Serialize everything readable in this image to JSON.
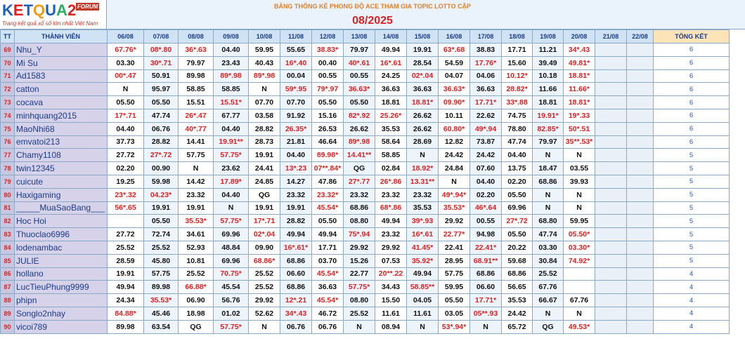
{
  "logo": {
    "brand": "KETQUA2",
    "forum": "FORUM",
    "tagline": "Trang kết quả xổ số lớn nhất Việt Nam"
  },
  "header": {
    "title": "BẢNG THỐNG KÊ PHONG ĐỘ ACE THAM GIA TOPIC  LOTTO CẶP",
    "month": "08/2025"
  },
  "columns": [
    "TT",
    "THÀNH VIÊN",
    "06/08",
    "07/08",
    "08/08",
    "09/08",
    "10/08",
    "11/08",
    "12/08",
    "13/08",
    "14/08",
    "15/08",
    "16/08",
    "17/08",
    "18/08",
    "19/08",
    "20/08",
    "21/08",
    "22/08",
    "TỔNG KẾT"
  ],
  "rows": [
    {
      "tt": "69",
      "name": "Nhu_Y",
      "vals": [
        "67.76*",
        "08*.80",
        "36*.63",
        "04.40",
        "59.95",
        "55.65",
        "38.83*",
        "79.97",
        "49.94",
        "19.91",
        "63*.68",
        "38.83",
        "17.71",
        "11.21",
        "34*.43"
      ],
      "total": "6"
    },
    {
      "tt": "70",
      "name": "Mi Su",
      "vals": [
        "03.30",
        "30*.71",
        "79.97",
        "23.43",
        "40.43",
        "16*.40",
        "00.40",
        "40*.61",
        "16*.61",
        "28.54",
        "54.59",
        "17.76*",
        "15.60",
        "39.49",
        "49.81*"
      ],
      "total": "6"
    },
    {
      "tt": "71",
      "name": "Ad1583",
      "vals": [
        "00*.47",
        "50.91",
        "89.98",
        "89*.98",
        "89*.98",
        "00.04",
        "00.55",
        "00.55",
        "24.25",
        "02*.04",
        "04.07",
        "04.06",
        "10.12*",
        "10.18",
        "18.81*"
      ],
      "total": "6"
    },
    {
      "tt": "72",
      "name": "catton",
      "vals": [
        "N",
        "95.97",
        "58.85",
        "58.85",
        "N",
        "59*.95",
        "79*.97",
        "36.63*",
        "36.63",
        "36.63",
        "36.63*",
        "36.63",
        "28.82*",
        "11.66",
        "11.66*"
      ],
      "total": "6"
    },
    {
      "tt": "73",
      "name": "cocava",
      "vals": [
        "05.50",
        "05.50",
        "15.51",
        "15.51*",
        "07.70",
        "07.70",
        "05.50",
        "05.50",
        "18.81",
        "18.81*",
        "09.90*",
        "17.71*",
        "33*.88",
        "18.81",
        "18.81*"
      ],
      "total": "6"
    },
    {
      "tt": "74",
      "name": "minhquang2015",
      "vals": [
        "17*.71",
        "47.74",
        "26*.47",
        "67.77",
        "03.58",
        "91.92",
        "15.16",
        "82*.92",
        "25.26*",
        "26.62",
        "10.11",
        "22.62",
        "74.75",
        "19.91*",
        "19*.33"
      ],
      "total": "6"
    },
    {
      "tt": "75",
      "name": "MaoNhi68",
      "vals": [
        "04.40",
        "06.76",
        "40*.77",
        "04.40",
        "28.82",
        "26.35*",
        "26.53",
        "26.62",
        "35.53",
        "26.62",
        "60.80*",
        "49*.94",
        "78.80",
        "82.85*",
        "50*.51"
      ],
      "total": "6"
    },
    {
      "tt": "76",
      "name": "emvatoi213",
      "vals": [
        "37.73",
        "28.82",
        "14.41",
        "19.91**",
        "28.73",
        "21.81",
        "46.64",
        "89*.98",
        "58.64",
        "28.69",
        "12.82",
        "73.87",
        "47.74",
        "79.97",
        "35**.53*"
      ],
      "total": "6"
    },
    {
      "tt": "77",
      "name": "Chamy1108",
      "vals": [
        "27.72",
        "27*.72",
        "57.75",
        "57.75*",
        "19.91",
        "04.40",
        "89.98*",
        "14.41**",
        "58.85",
        "N",
        "24.42",
        "24.42",
        "04.40",
        "N",
        "N"
      ],
      "total": "5"
    },
    {
      "tt": "78",
      "name": "twin12345",
      "vals": [
        "02.20",
        "00.90",
        "N",
        "23.62",
        "24.41",
        "13*.23",
        "07**.84*",
        "QG",
        "02.84",
        "18.92*",
        "24.84",
        "07.60",
        "13.75",
        "18.47",
        "03.55"
      ],
      "total": "5"
    },
    {
      "tt": "79",
      "name": "cuicute",
      "vals": [
        "19.25",
        "59.98",
        "14.42",
        "17.89*",
        "24.85",
        "14.27",
        "47.86",
        "27*.77",
        "26*.86",
        "13.31**",
        "N",
        "04.40",
        "02.20",
        "68.86",
        "39.93"
      ],
      "total": "5"
    },
    {
      "tt": "80",
      "name": "Haxigaming",
      "vals": [
        "23*.32",
        "04.23*",
        "23.32",
        "04.40",
        "QG",
        "23.32",
        "23.32*",
        "23.32",
        "23.32",
        "23.32",
        "49*.94*",
        "02.20",
        "05.50",
        "N",
        "N"
      ],
      "total": "5"
    },
    {
      "tt": "81",
      "name": "_____MuaSaoBang___",
      "vals": [
        "56*.65",
        "19.91",
        "19.91",
        "N",
        "19.91",
        "19.91",
        "45.54*",
        "68.86",
        "68*.86",
        "35.53",
        "35.53*",
        "46*.64",
        "69.96",
        "N",
        "N"
      ],
      "total": "5"
    },
    {
      "tt": "82",
      "name": "Hoc Hoi",
      "vals": [
        "",
        "05.50",
        "35.53*",
        "57.75*",
        "17*.71",
        "28.82",
        "05.50",
        "08.80",
        "49.94",
        "39*.93",
        "29.92",
        "00.55",
        "27*.72",
        "68.80",
        "59.95"
      ],
      "total": "5"
    },
    {
      "tt": "83",
      "name": "Thuoclao6996",
      "vals": [
        "27.72",
        "72.74",
        "34.61",
        "69.96",
        "02*.04",
        "49.94",
        "49.94",
        "75*.94",
        "23.32",
        "16*.61",
        "22.77*",
        "94.98",
        "05.50",
        "47.74",
        "05.50*"
      ],
      "total": "5"
    },
    {
      "tt": "84",
      "name": "lodenambac",
      "vals": [
        "25.52",
        "25.52",
        "52.93",
        "48.84",
        "09.90",
        "16*.61*",
        "17.71",
        "29.92",
        "29.92",
        "41.45*",
        "22.41",
        "22.41*",
        "20.22",
        "03.30",
        "03.30*"
      ],
      "total": "5"
    },
    {
      "tt": "85",
      "name": "JULIE",
      "vals": [
        "28.59",
        "45.80",
        "10.81",
        "69.96",
        "68.86*",
        "68.86",
        "03.70",
        "15.26",
        "07.53",
        "35.92*",
        "28.95",
        "68.91**",
        "59.68",
        "30.84",
        "74.92*"
      ],
      "total": "5"
    },
    {
      "tt": "86",
      "name": "hollano",
      "vals": [
        "19.91",
        "57.75",
        "25.52",
        "70.75*",
        "25.52",
        "06.60",
        "45.54*",
        "22.77",
        "20**.22",
        "49.94",
        "57.75",
        "68.86",
        "68.86",
        "25.52",
        ""
      ],
      "total": "4"
    },
    {
      "tt": "87",
      "name": "LucTieuPhung9999",
      "vals": [
        "49.94",
        "89.98",
        "66.88*",
        "45.54",
        "25.52",
        "68.86",
        "36.63",
        "57.75*",
        "34.43",
        "58.85**",
        "59.95",
        "06.60",
        "56.65",
        "67.76",
        ""
      ],
      "total": "4"
    },
    {
      "tt": "88",
      "name": "phipn",
      "vals": [
        "24.34",
        "35.53*",
        "06.90",
        "56.76",
        "29.92",
        "12*.21",
        "45.54*",
        "08.80",
        "15.50",
        "04.05",
        "05.50",
        "17.71*",
        "35.53",
        "66.67",
        "67.76"
      ],
      "total": "4"
    },
    {
      "tt": "89",
      "name": "Songlo2nhay",
      "vals": [
        "84.88*",
        "45.46",
        "18.98",
        "01.02",
        "52.62",
        "34*.43",
        "46.72",
        "25.52",
        "11.61",
        "11.61",
        "03.05",
        "05**.93",
        "24.42",
        "N",
        "N"
      ],
      "total": "4"
    },
    {
      "tt": "90",
      "name": "vicoi789",
      "vals": [
        "89.98",
        "63.54",
        "QG",
        "57.75*",
        "N",
        "06.76",
        "06.76",
        "N",
        "08.94",
        "N",
        "53*.94*",
        "N",
        "65.72",
        "QG",
        "49.53*"
      ],
      "total": "4"
    }
  ],
  "colors": {
    "red": "#e02020",
    "blue": "#1a3a8a",
    "header_bg": "#cfe3f5",
    "name_bg": "#d6d2ea"
  }
}
